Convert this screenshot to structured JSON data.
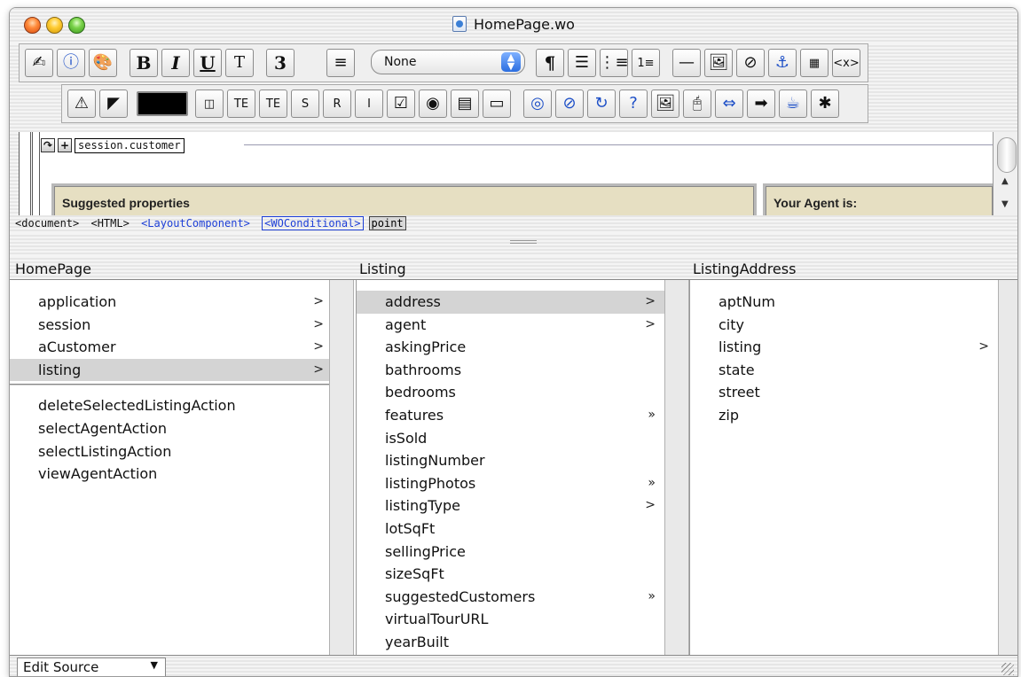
{
  "window": {
    "title": "HomePage.wo"
  },
  "toolbar1": {
    "bold": "B",
    "italic": "I",
    "underline": "U",
    "typewriter": "T",
    "size": "3",
    "format_select": "None",
    "paragraph": "¶"
  },
  "content": {
    "conditional_binding": "session.customer",
    "panel_left_title": "Suggested properties",
    "panel_right_title": "Your Agent is:"
  },
  "path": {
    "items": [
      "<document>",
      "<HTML>",
      "<LayoutComponent>",
      "<WOConditional>",
      "point"
    ]
  },
  "browser": {
    "columns": [
      {
        "header": "HomePage"
      },
      {
        "header": "Listing"
      },
      {
        "header": "ListingAddress"
      }
    ],
    "col1_keys": [
      {
        "label": "application",
        "arrow": ">"
      },
      {
        "label": "session",
        "arrow": ">"
      },
      {
        "label": "aCustomer",
        "arrow": ">"
      },
      {
        "label": "listing",
        "arrow": ">"
      }
    ],
    "col1_actions": [
      {
        "label": "deleteSelectedListingAction"
      },
      {
        "label": "selectAgentAction"
      },
      {
        "label": "selectListingAction"
      },
      {
        "label": "viewAgentAction"
      }
    ],
    "col2": [
      {
        "label": "address",
        "arrow": ">"
      },
      {
        "label": "agent",
        "arrow": ">"
      },
      {
        "label": "askingPrice",
        "arrow": ""
      },
      {
        "label": "bathrooms",
        "arrow": ""
      },
      {
        "label": "bedrooms",
        "arrow": ""
      },
      {
        "label": "features",
        "arrow": "»"
      },
      {
        "label": "isSold",
        "arrow": ""
      },
      {
        "label": "listingNumber",
        "arrow": ""
      },
      {
        "label": "listingPhotos",
        "arrow": "»"
      },
      {
        "label": "listingType",
        "arrow": ">"
      },
      {
        "label": "lotSqFt",
        "arrow": ""
      },
      {
        "label": "sellingPrice",
        "arrow": ""
      },
      {
        "label": "sizeSqFt",
        "arrow": ""
      },
      {
        "label": "suggestedCustomers",
        "arrow": "»"
      },
      {
        "label": "virtualTourURL",
        "arrow": ""
      },
      {
        "label": "yearBuilt",
        "arrow": ""
      }
    ],
    "col3": [
      {
        "label": "aptNum",
        "arrow": ""
      },
      {
        "label": "city",
        "arrow": ""
      },
      {
        "label": "listing",
        "arrow": ">"
      },
      {
        "label": "state",
        "arrow": ""
      },
      {
        "label": "street",
        "arrow": ""
      },
      {
        "label": "zip",
        "arrow": ""
      }
    ]
  },
  "bottom": {
    "mode_select": "Edit Source"
  }
}
